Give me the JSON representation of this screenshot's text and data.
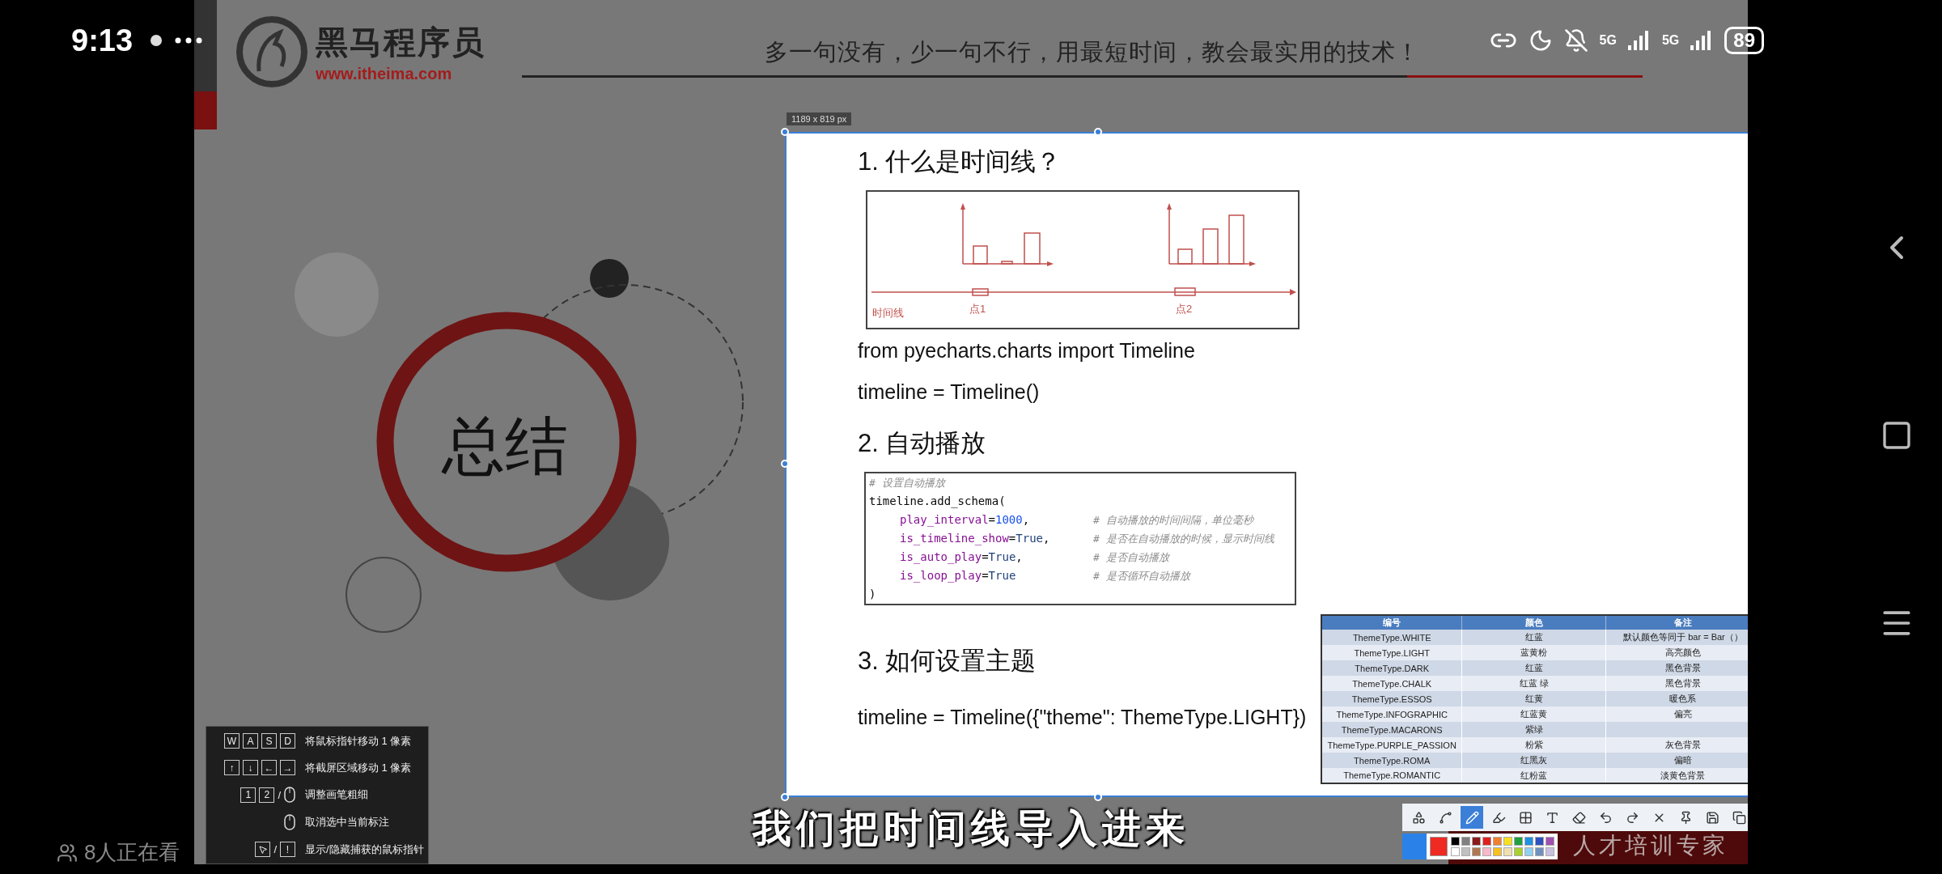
{
  "status_bar": {
    "time": "9:13",
    "networks": [
      "5G",
      "5G"
    ],
    "battery": "89"
  },
  "slide": {
    "logo_title": "黑马程序员",
    "logo_url": "www.itheima.com",
    "slogan": "多一句没有，少一句不行，用最短时间，教会最实用的技术！",
    "summary": "总结",
    "footer": "人才培训专家"
  },
  "capture": {
    "size_label": "1189 x 819  px",
    "heading_1": "1. 什么是时间线？",
    "diagram_labels": [
      "时间线",
      "点1",
      "点2"
    ],
    "import_line": "from pyecharts.charts import Timeline",
    "create_line": "timeline = Timeline()",
    "heading_2": "2. 自动播放",
    "code_lines": [
      {
        "kind": "comment",
        "text": "#  设置自动播放"
      },
      {
        "kind": "plain",
        "text": "timeline.add_schema("
      },
      {
        "kind": "param",
        "name": "play_interval",
        "operator": "=",
        "value": "1000",
        "color": "#1750eb",
        "punct": ",",
        "comment": "#  自动播放的时间间隔，单位毫秒"
      },
      {
        "kind": "param",
        "name": "is_timeline_show",
        "operator": "=",
        "value": "True",
        "color": "#1f3f78",
        "punct": ",",
        "comment": "#  是否在自动播放的时候，显示时间线"
      },
      {
        "kind": "param",
        "name": "is_auto_play",
        "operator": "=",
        "value": "True",
        "color": "#1f3f78",
        "punct": ",",
        "comment": "#  是否自动播放"
      },
      {
        "kind": "param",
        "name": "is_loop_play",
        "operator": "=",
        "value": "True",
        "color": "#1f3f78",
        "comment": "#  是否循环自动播放"
      },
      {
        "kind": "plain",
        "text": ")"
      }
    ],
    "heading_3": "3. 如何设置主题",
    "theme_line": "timeline = Timeline({\"theme\": ThemeType.LIGHT})",
    "theme_table": {
      "columns": [
        "编号",
        "颜色",
        "备注"
      ],
      "rows": [
        [
          "ThemeType.WHITE",
          "红蓝",
          "默认颜色等同于 bar = Bar（）"
        ],
        [
          "ThemeType.LIGHT",
          "蓝黄粉",
          "高亮颜色"
        ],
        [
          "ThemeType.DARK",
          "红蓝",
          "黑色背景"
        ],
        [
          "ThemeType.CHALK",
          "红蓝 绿",
          "黑色背景"
        ],
        [
          "ThemeType.ESSOS",
          "红黄",
          "暖色系"
        ],
        [
          "ThemeType.INFOGRAPHIC",
          "红蓝黄",
          "偏亮"
        ],
        [
          "ThemeType.MACARONS",
          "紫绿",
          ""
        ],
        [
          "ThemeType.PURPLE_PASSION",
          "粉紫",
          "灰色背景"
        ],
        [
          "ThemeType.ROMA",
          "红黑灰",
          "偏暗"
        ],
        [
          "ThemeType.ROMANTIC",
          "红粉蓝",
          "淡黄色背景"
        ]
      ]
    }
  },
  "shortcuts": [
    {
      "items": [
        {
          "kind": "key",
          "label": "W"
        },
        {
          "kind": "key",
          "label": "A"
        },
        {
          "kind": "key",
          "label": "S"
        },
        {
          "kind": "key",
          "label": "D"
        }
      ],
      "text": "将鼠标指针移动 1 像素"
    },
    {
      "items": [
        {
          "kind": "key",
          "label": "↑"
        },
        {
          "kind": "key",
          "label": "↓"
        },
        {
          "kind": "key",
          "label": "←"
        },
        {
          "kind": "key",
          "label": "→"
        }
      ],
      "text": "将截屏区域移动 1 像素"
    },
    {
      "items": [
        {
          "kind": "key",
          "label": "1"
        },
        {
          "kind": "key",
          "label": "2"
        },
        {
          "kind": "sep",
          "label": "/"
        },
        {
          "kind": "mouse"
        }
      ],
      "text": "调整画笔粗细"
    },
    {
      "items": [
        {
          "kind": "mouse"
        }
      ],
      "text": "取消选中当前标注"
    },
    {
      "items": [
        {
          "kind": "cursor"
        },
        {
          "kind": "sep",
          "label": "/"
        },
        {
          "kind": "key",
          "label": "!"
        }
      ],
      "text": "显示/隐藏捕获的鼠标指针"
    }
  ],
  "tools": [
    {
      "kind": "shape",
      "selected": false
    },
    {
      "kind": "line",
      "selected": false
    },
    {
      "kind": "pencil",
      "selected": true
    },
    {
      "kind": "marker",
      "selected": false
    },
    {
      "kind": "mosaic",
      "selected": false
    },
    {
      "kind": "text",
      "selected": false
    },
    {
      "kind": "eraser",
      "selected": false
    },
    {
      "kind": "undo",
      "selected": false
    },
    {
      "kind": "redo",
      "selected": false
    },
    {
      "kind": "close",
      "selected": false
    },
    {
      "kind": "pin",
      "selected": false
    },
    {
      "kind": "save",
      "selected": false
    },
    {
      "kind": "copy",
      "selected": false
    }
  ],
  "palette": {
    "current": {
      "color": "#ee2a22"
    },
    "swatches": [
      {
        "color": "#000000"
      },
      {
        "color": "#808080"
      },
      {
        "color": "#8b1a1a"
      },
      {
        "color": "#e02020"
      },
      {
        "color": "#f08030"
      },
      {
        "color": "#f8e020"
      },
      {
        "color": "#20a040"
      },
      {
        "color": "#2090e0"
      },
      {
        "color": "#3050c0"
      },
      {
        "color": "#a050b0"
      },
      {
        "color": "#ffffff"
      },
      {
        "color": "#c0c0c0"
      },
      {
        "color": "#b07850"
      },
      {
        "color": "#f8b8c8"
      },
      {
        "color": "#f8c020"
      },
      {
        "color": "#f0e0b0"
      },
      {
        "color": "#a8d030"
      },
      {
        "color": "#90d0f0"
      },
      {
        "color": "#7090c0"
      },
      {
        "color": "#c8c0e0"
      }
    ]
  },
  "subtitle": "我们把时间线导入进来",
  "viewers": "8人正在看"
}
